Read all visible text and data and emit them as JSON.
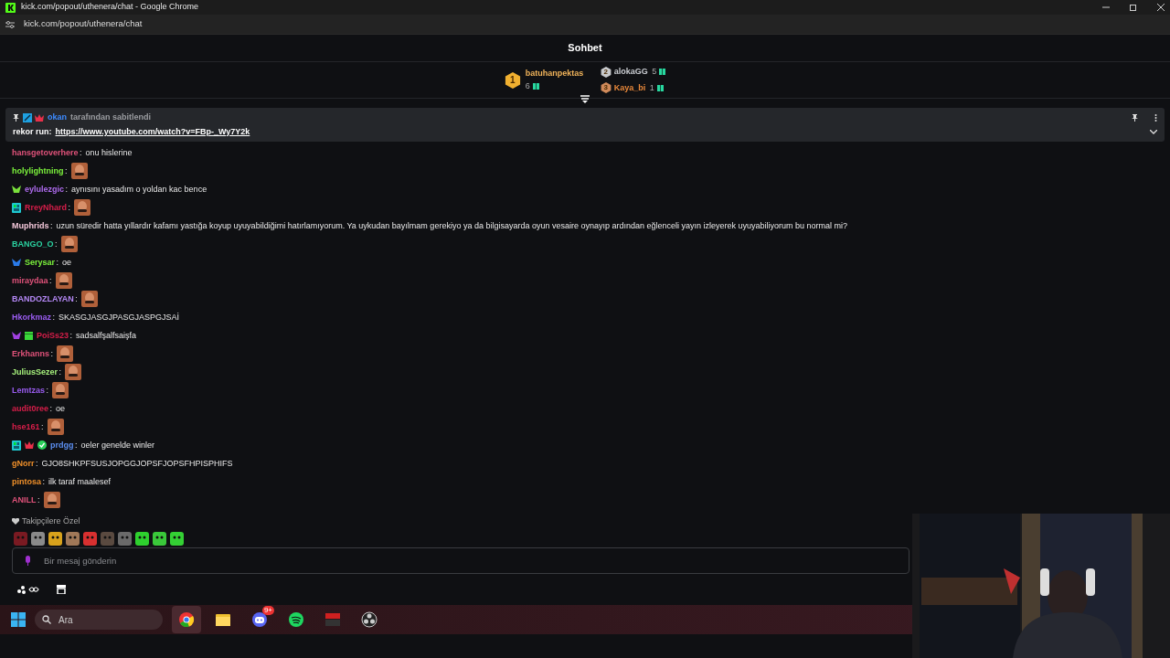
{
  "window": {
    "title": "kick.com/popout/uthenera/chat - Google Chrome",
    "url": "kick.com/popout/uthenera/chat"
  },
  "header": {
    "title": "Sohbet"
  },
  "leaderboard": [
    {
      "rank": "1",
      "name": "batuhanpektas",
      "count": "6",
      "color": "#f0b35a"
    },
    {
      "rank": "2",
      "name": "alokaGG",
      "count": "5",
      "color": "#c9ccd1"
    },
    {
      "rank": "3",
      "name": "Kaya_bi",
      "count": "1",
      "color": "#e8883a"
    }
  ],
  "pinned": {
    "by": "okan",
    "by_badges": [
      {
        "kind": "moderator"
      },
      {
        "kind": "vip"
      }
    ],
    "suffix": "tarafından sabitlendi",
    "label": "rekor run:",
    "link": "https://www.youtube.com/watch?v=FBp-_Wy7Y2k"
  },
  "messages": [
    {
      "user": "hansgetoverhere",
      "color": "#e0527a",
      "separator": ":",
      "text": "onu hislerine"
    },
    {
      "user": "holylightning",
      "color": "#7cf23c",
      "separator": ":",
      "emote": true
    },
    {
      "user": "eylulezgic",
      "color": "#b06cf0",
      "badges": [
        {
          "kind": "sub-green"
        }
      ],
      "separator": ":",
      "text": "aynısını yasadım o yoldan kac bence"
    },
    {
      "user": "RreyNhard",
      "color": "#d81e4a",
      "badges": [
        {
          "kind": "og"
        }
      ],
      "separator": ":",
      "emote": true
    },
    {
      "user": "Muphrids",
      "color": "#f2c6d8",
      "separator": ":",
      "text": "uzun süredir hatta yıllardır kafamı yastığa koyup uyuyabildiğimi hatırlamıyorum. Ya uykudan bayılmam gerekiyo ya da bilgisayarda oyun vesaire oynayıp ardından eğlenceli yayın izleyerek uyuyabiliyorum bu normal mi?"
    },
    {
      "user": "BANGO_O",
      "color": "#2ad1a0",
      "separator": ":",
      "emote": true
    },
    {
      "user": "Serysar",
      "color": "#7cf23c",
      "badges": [
        {
          "kind": "sub-blue"
        }
      ],
      "separator": ":",
      "text": "oe"
    },
    {
      "user": "miraydaa",
      "color": "#e0527a",
      "separator": ":",
      "emote": true
    },
    {
      "user": "BANDOZLAYAN",
      "color": "#b488f5",
      "separator": ":",
      "emote": true
    },
    {
      "user": "Hkorkmaz",
      "color": "#9a5cf0",
      "separator": ":",
      "text": "SKASGJASGJPASGJASPGJSAİ"
    },
    {
      "user": "PoiSs23",
      "color": "#d81e4a",
      "badges": [
        {
          "kind": "founder"
        },
        {
          "kind": "gift"
        }
      ],
      "separator": ":",
      "text": "sadsalfşalfsaişfa"
    },
    {
      "user": "Erkhanns",
      "color": "#e0527a",
      "separator": ":",
      "emote": true
    },
    {
      "user": "JuliusSezer",
      "color": "#a6f07c",
      "separator": ":",
      "emote": true
    },
    {
      "user": "Lemtzas",
      "color": "#9a5cf0",
      "separator": ":",
      "emote": true
    },
    {
      "user": "audit0ree",
      "color": "#d81e4a",
      "separator": ":",
      "text": "oe"
    },
    {
      "user": "hse161",
      "color": "#d81e4a",
      "separator": ":",
      "emote": true
    },
    {
      "user": "prdgg",
      "color": "#5b8ef0",
      "badges": [
        {
          "kind": "og"
        },
        {
          "kind": "vip"
        },
        {
          "kind": "verified"
        }
      ],
      "separator": ":",
      "text": "oeler genelde winler"
    },
    {
      "user": "gNorr",
      "color": "#f0902a",
      "separator": ":",
      "text": "GJO8SHKPFSUSJOPGGJOPSFJOPSFHPISPHIFS"
    },
    {
      "user": "pintosa",
      "color": "#f0902a",
      "separator": ":",
      "text": "ilk taraf maalesef"
    },
    {
      "user": "ANILL",
      "color": "#e0527a",
      "separator": ":",
      "emote": true
    }
  ],
  "emote_bar": {
    "label": "Takipçilere Özel",
    "emotes": [
      {
        "color": "#7a1a22"
      },
      {
        "color": "#8a8a8a"
      },
      {
        "color": "#d8a21c"
      },
      {
        "color": "#a07858"
      },
      {
        "color": "#d83030"
      },
      {
        "color": "#5a4a40"
      },
      {
        "color": "#6a6a6a"
      },
      {
        "color": "#2ed02e"
      },
      {
        "color": "#3ac83a"
      },
      {
        "color": "#34d034"
      }
    ]
  },
  "input": {
    "placeholder": "Bir mesaj gönderin"
  },
  "taskbar": {
    "search_placeholder": "Ara",
    "apps": [
      {
        "kind": "chrome",
        "active": true
      },
      {
        "kind": "folder",
        "active": false
      },
      {
        "kind": "discord",
        "active": false,
        "badge": "9+"
      },
      {
        "kind": "spotify",
        "active": false
      },
      {
        "kind": "mixer",
        "active": false
      },
      {
        "kind": "obs",
        "active": false
      }
    ]
  }
}
